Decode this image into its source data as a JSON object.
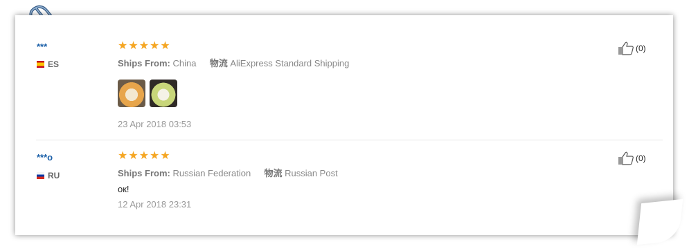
{
  "reviews": [
    {
      "user": "***",
      "country_code": "ES",
      "rating_stars": "★★★★★",
      "ships_from_label": "Ships From:",
      "ships_from_value": "China",
      "logistics_label": "物流",
      "logistics_value": "AliExpress Standard Shipping",
      "date": "23 Apr 2018 03:53",
      "helpful_count": "(0)",
      "images": [
        "review-photo-1",
        "review-photo-2"
      ]
    },
    {
      "user": "***o",
      "country_code": "RU",
      "rating_stars": "★★★★★",
      "ships_from_label": "Ships From:",
      "ships_from_value": "Russian Federation",
      "logistics_label": "物流",
      "logistics_value": "Russian Post",
      "comment": "ок!",
      "date": "12 Apr 2018 23:31",
      "helpful_count": "(0)"
    }
  ],
  "colors": {
    "star": "#f5a623",
    "username": "#1a5fa8",
    "meta_text": "#888888"
  }
}
